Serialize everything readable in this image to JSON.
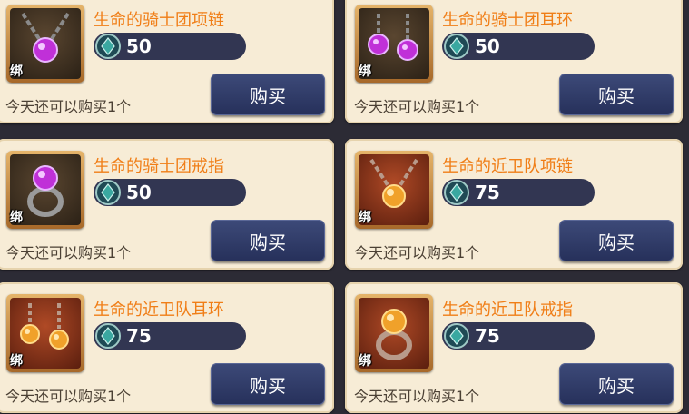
{
  "colors": {
    "item_name": "#f07e17",
    "price_bar": "#323652",
    "button": "#2e3864",
    "card_bg": "#f7ecd6"
  },
  "items": [
    {
      "name": "生命的骑士团项链",
      "price": "50",
      "limit": "今天还可以购买1个",
      "buy_label": "购买",
      "bind_label": "绑",
      "icon": "purple-gem-necklace-icon"
    },
    {
      "name": "生命的骑士团耳环",
      "price": "50",
      "limit": "今天还可以购买1个",
      "buy_label": "购买",
      "bind_label": "绑",
      "icon": "purple-gem-earrings-icon"
    },
    {
      "name": "生命的骑士团戒指",
      "price": "50",
      "limit": "今天还可以购买1个",
      "buy_label": "购买",
      "bind_label": "绑",
      "icon": "purple-gem-ring-icon"
    },
    {
      "name": "生命的近卫队项链",
      "price": "75",
      "limit": "今天还可以购买1个",
      "buy_label": "购买",
      "bind_label": "绑",
      "icon": "amber-gem-necklace-icon"
    },
    {
      "name": "生命的近卫队耳环",
      "price": "75",
      "limit": "今天还可以购买1个",
      "buy_label": "购买",
      "bind_label": "绑",
      "icon": "amber-gem-earrings-icon"
    },
    {
      "name": "生命的近卫队戒指",
      "price": "75",
      "limit": "今天还可以购买1个",
      "buy_label": "购买",
      "bind_label": "绑",
      "icon": "amber-gem-ring-icon"
    }
  ]
}
